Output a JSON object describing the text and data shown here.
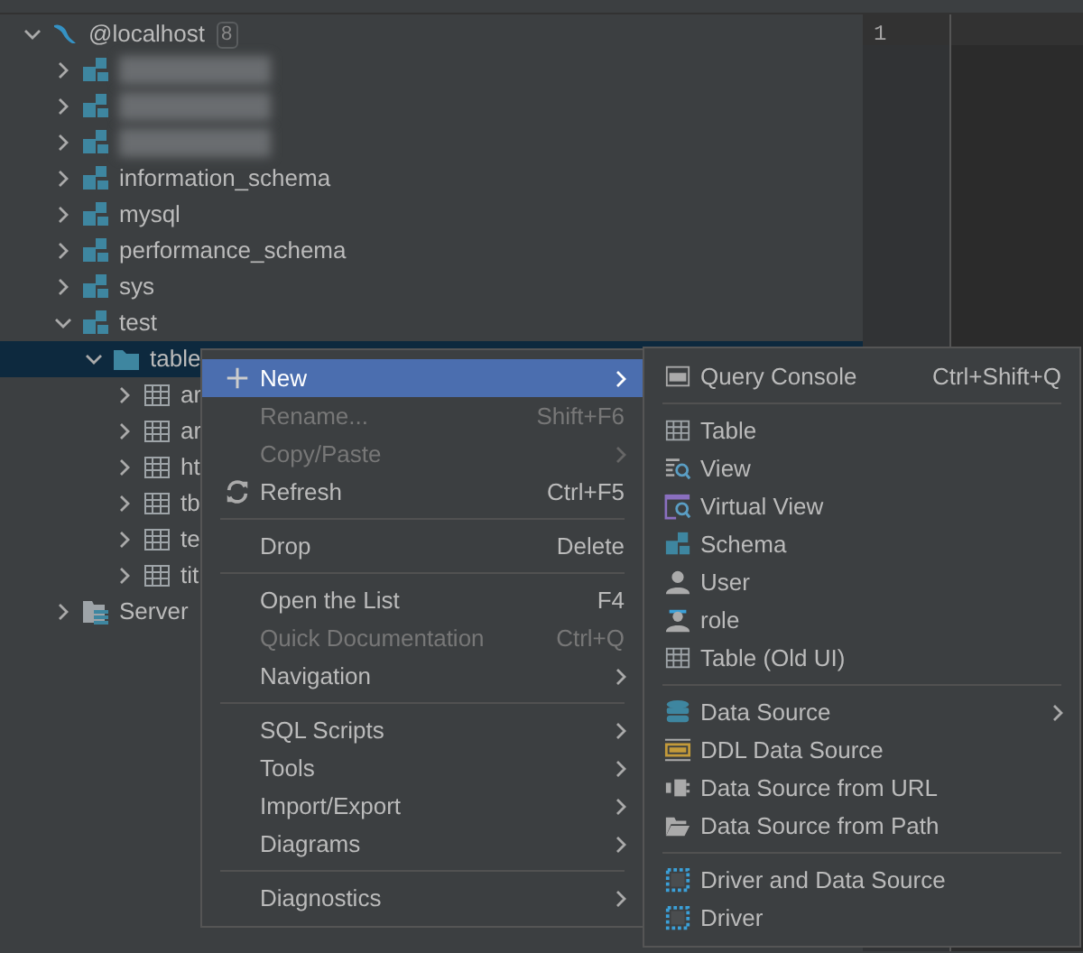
{
  "tree": [
    {
      "kind": "host",
      "label": "@localhost",
      "badge": "8",
      "expanded": true,
      "children": [
        {
          "kind": "redacted",
          "expanded": false
        },
        {
          "kind": "redacted",
          "expanded": false
        },
        {
          "kind": "redacted",
          "expanded": false
        },
        {
          "kind": "schema",
          "label": "information_schema",
          "expanded": false
        },
        {
          "kind": "schema",
          "label": "mysql",
          "expanded": false
        },
        {
          "kind": "schema",
          "label": "performance_schema",
          "expanded": false
        },
        {
          "kind": "schema",
          "label": "sys",
          "expanded": false
        },
        {
          "kind": "schema",
          "label": "test",
          "expanded": true,
          "children": [
            {
              "kind": "folder",
              "label": "table",
              "expanded": true,
              "selected": true,
              "children": [
                {
                  "kind": "table",
                  "label": "ar",
                  "expanded": false
                },
                {
                  "kind": "table",
                  "label": "ar",
                  "expanded": false
                },
                {
                  "kind": "table",
                  "label": "ht",
                  "expanded": false
                },
                {
                  "kind": "table",
                  "label": "tb",
                  "expanded": false
                },
                {
                  "kind": "table",
                  "label": "te",
                  "expanded": false
                },
                {
                  "kind": "table",
                  "label": "tit",
                  "expanded": false
                }
              ]
            }
          ]
        },
        {
          "kind": "server-objects",
          "label": "Server",
          "expanded": false
        }
      ]
    }
  ],
  "editor": {
    "line_numbers": [
      "1"
    ]
  },
  "menu": {
    "items": [
      {
        "kind": "item",
        "label": "New",
        "has_submenu": true,
        "selected": true,
        "disabled": false
      },
      {
        "kind": "item",
        "label": "Rename...",
        "shortcut": "Shift+F6",
        "selected": false,
        "disabled": true
      },
      {
        "kind": "item",
        "label": "Copy/Paste",
        "has_submenu": true,
        "selected": false,
        "disabled": true
      },
      {
        "kind": "item",
        "label": "Refresh",
        "shortcut": "Ctrl+F5",
        "selected": false,
        "disabled": false
      },
      {
        "kind": "separator"
      },
      {
        "kind": "item",
        "label": "Drop",
        "shortcut": "Delete",
        "selected": false,
        "disabled": false
      },
      {
        "kind": "separator"
      },
      {
        "kind": "item",
        "label": "Open the List",
        "shortcut": "F4",
        "selected": false,
        "disabled": false
      },
      {
        "kind": "item",
        "label": "Quick Documentation",
        "shortcut": "Ctrl+Q",
        "selected": false,
        "disabled": true
      },
      {
        "kind": "item",
        "label": "Navigation",
        "has_submenu": true,
        "selected": false,
        "disabled": false
      },
      {
        "kind": "separator"
      },
      {
        "kind": "item",
        "label": "SQL Scripts",
        "has_submenu": true,
        "selected": false,
        "disabled": false
      },
      {
        "kind": "item",
        "label": "Tools",
        "has_submenu": true,
        "selected": false,
        "disabled": false
      },
      {
        "kind": "item",
        "label": "Import/Export",
        "has_submenu": true,
        "selected": false,
        "disabled": false
      },
      {
        "kind": "item",
        "label": "Diagrams",
        "has_submenu": true,
        "selected": false,
        "disabled": false
      },
      {
        "kind": "separator"
      },
      {
        "kind": "item",
        "label": "Diagnostics",
        "has_submenu": true,
        "selected": false,
        "disabled": false
      }
    ]
  },
  "submenu": {
    "items": [
      {
        "kind": "item",
        "label": "Query Console",
        "shortcut": "Ctrl+Shift+Q"
      },
      {
        "kind": "separator"
      },
      {
        "kind": "item",
        "label": "Table"
      },
      {
        "kind": "item",
        "label": "View"
      },
      {
        "kind": "item",
        "label": "Virtual View"
      },
      {
        "kind": "item",
        "label": "Schema"
      },
      {
        "kind": "item",
        "label": "User"
      },
      {
        "kind": "item",
        "label": "role"
      },
      {
        "kind": "item",
        "label": "Table (Old UI)"
      },
      {
        "kind": "separator"
      },
      {
        "kind": "item",
        "label": "Data Source",
        "has_submenu": true
      },
      {
        "kind": "item",
        "label": "DDL Data Source"
      },
      {
        "kind": "item",
        "label": "Data Source from URL"
      },
      {
        "kind": "item",
        "label": "Data Source from Path"
      },
      {
        "kind": "separator"
      },
      {
        "kind": "item",
        "label": "Driver and Data Source"
      },
      {
        "kind": "item",
        "label": "Driver"
      }
    ]
  }
}
